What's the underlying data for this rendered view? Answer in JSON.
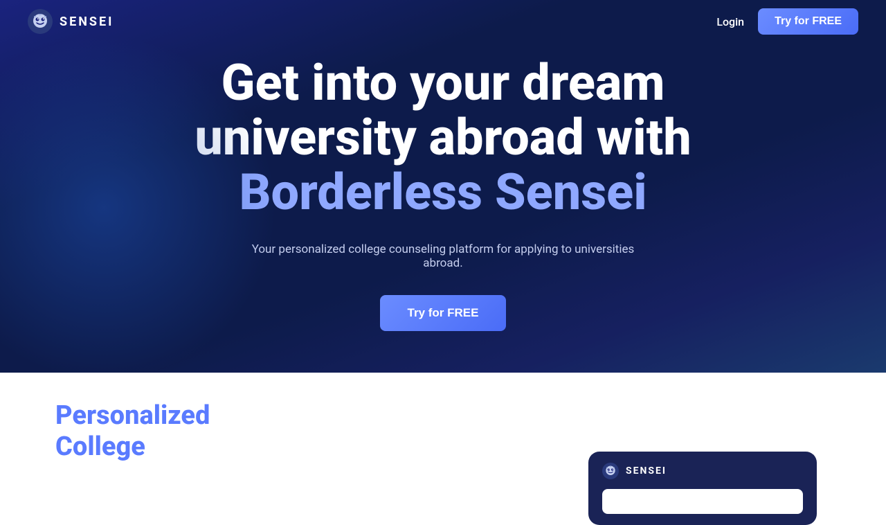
{
  "navbar": {
    "logo_text": "SENSEI",
    "login_label": "Login",
    "try_free_label": "Try for FREE"
  },
  "hero": {
    "heading_line1": "Get into your dream",
    "heading_line2": "university abroad with",
    "heading_line3": "Borderless Sensei",
    "subtext": "Your personalized college counseling platform for applying to universities abroad.",
    "try_free_label": "Try for FREE"
  },
  "below_hero": {
    "personalized_heading": "Personalized College"
  },
  "sensei_card": {
    "logo_text": "SENSEI"
  },
  "colors": {
    "accent_blue": "#6b8cff",
    "dark_bg": "#0d1b4b",
    "highlight": "#8fa8ff",
    "card_bg": "#1a2356"
  }
}
